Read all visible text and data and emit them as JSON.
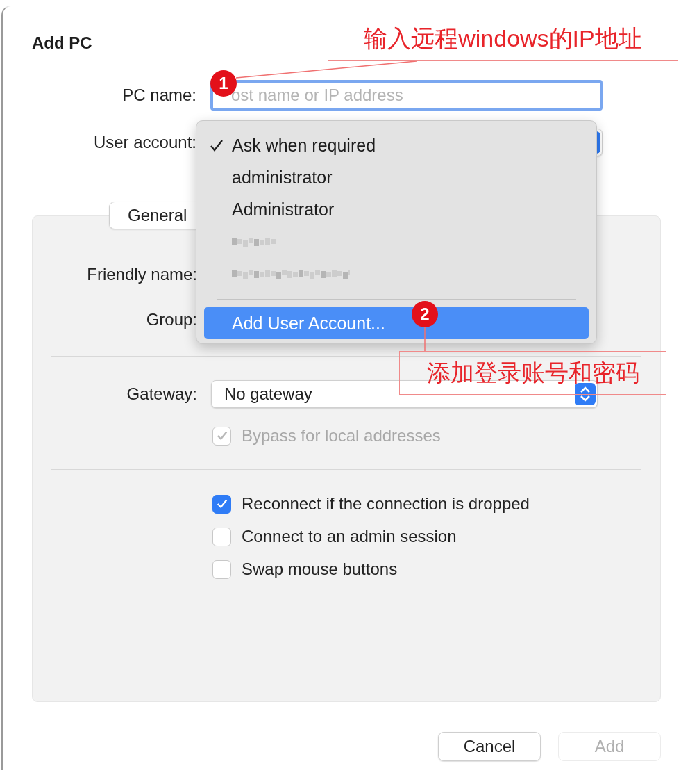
{
  "window": {
    "title": "Add PC"
  },
  "pc_name": {
    "label": "PC name:",
    "placeholder": "ost name or IP address",
    "focused": true
  },
  "user_account": {
    "label": "User account:",
    "menu": [
      {
        "kind": "option",
        "label": "Ask when required",
        "selected": true
      },
      {
        "kind": "option",
        "label": "administrator",
        "selected": false
      },
      {
        "kind": "option",
        "label": "Administrator",
        "selected": false
      },
      {
        "kind": "redacted"
      },
      {
        "kind": "redacted"
      },
      {
        "kind": "separator"
      },
      {
        "kind": "action",
        "label": "Add User Account...",
        "highlighted": true
      }
    ]
  },
  "tabs": [
    {
      "label": "General",
      "selected": true
    }
  ],
  "friendly_name": {
    "label": "Friendly name:"
  },
  "group": {
    "label": "Group:"
  },
  "gateway": {
    "label": "Gateway:",
    "value": "No gateway",
    "bypass": {
      "label": "Bypass for local addresses",
      "checked": true,
      "disabled": true
    }
  },
  "options": [
    {
      "label": "Reconnect if the connection is dropped",
      "checked": true
    },
    {
      "label": "Connect to an admin session",
      "checked": false
    },
    {
      "label": "Swap mouse buttons",
      "checked": false
    }
  ],
  "buttons": [
    {
      "label": "Cancel",
      "disabled": false
    },
    {
      "label": "Add",
      "disabled": true
    }
  ],
  "annotations": [
    {
      "number": "1",
      "note": "输入远程windows的IP地址"
    },
    {
      "number": "2",
      "note": "添加登录账号和密码"
    }
  ]
}
